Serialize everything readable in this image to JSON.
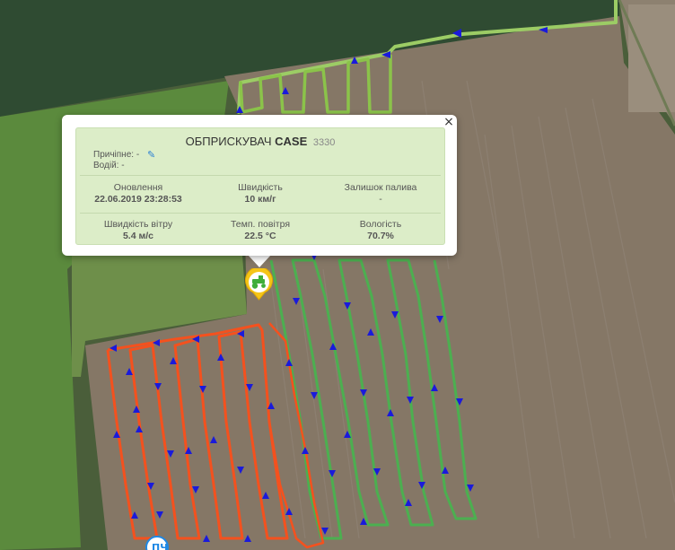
{
  "popup": {
    "title_prefix": "ОБПРИСКУВАЧ",
    "title_bold": "CASE",
    "title_number": "3330",
    "trailer_label": "Причіпне: -",
    "driver_label": "Водій: -",
    "close": "×",
    "row1": [
      {
        "label": "Оновлення",
        "value": "22.06.2019 23:28:53"
      },
      {
        "label": "Швидкість",
        "value": "10 км/г"
      },
      {
        "label": "Залишок палива",
        "value": "-"
      }
    ],
    "row2": [
      {
        "label": "Швидкість вітру",
        "value": "5.4 м/с"
      },
      {
        "label": "Темп. повітря",
        "value": "22.5 °C"
      },
      {
        "label": "Вологість",
        "value": "70.7%"
      }
    ]
  },
  "icons": [
    "close-icon",
    "pencil-icon",
    "tractor-icon",
    "direction-arrow-icon"
  ],
  "colors": {
    "track_green": "#8bc34a",
    "track_bright_green": "#4caf50",
    "track_red": "#f4511e",
    "arrow_blue": "#1a1adb",
    "marker_yellow": "#f5c518",
    "card_bg": "#dcedc8"
  }
}
